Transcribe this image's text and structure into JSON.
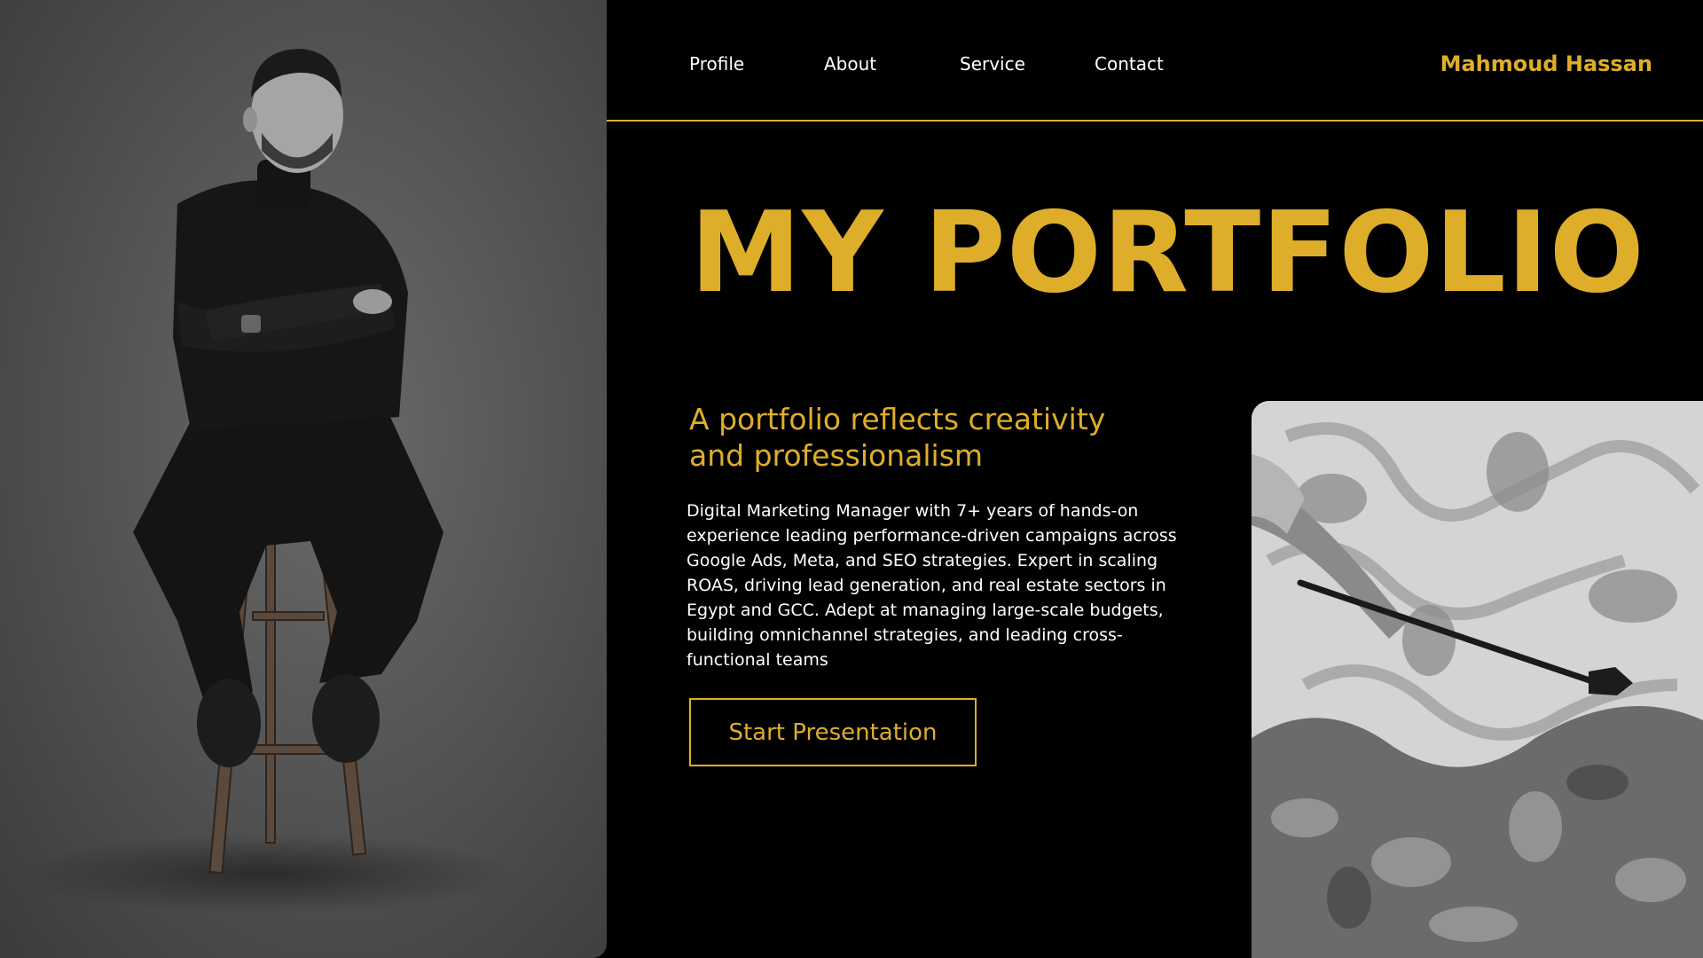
{
  "nav": {
    "items": [
      {
        "label": "Profile"
      },
      {
        "label": "About"
      },
      {
        "label": "Service"
      },
      {
        "label": "Contact"
      }
    ],
    "brand": "Mahmoud Hassan"
  },
  "hero": {
    "title": "MY PORTFOLIO",
    "subtitle_line1": "A portfolio reflects creativity",
    "subtitle_line2": "and professionalism",
    "description": "Digital Marketing Manager with 7+ years of hands-on experience leading performance-driven campaigns across Google Ads, Meta, and SEO strategies. Expert in scaling ROAS, driving lead generation, and real estate sectors in Egypt and GCC. Adept at managing large-scale budgets, building omnichannel strategies, and leading cross-functional teams",
    "cta_label": "Start Presentation"
  },
  "colors": {
    "accent": "#deae2b",
    "background": "#000000",
    "text": "#ffffff"
  }
}
